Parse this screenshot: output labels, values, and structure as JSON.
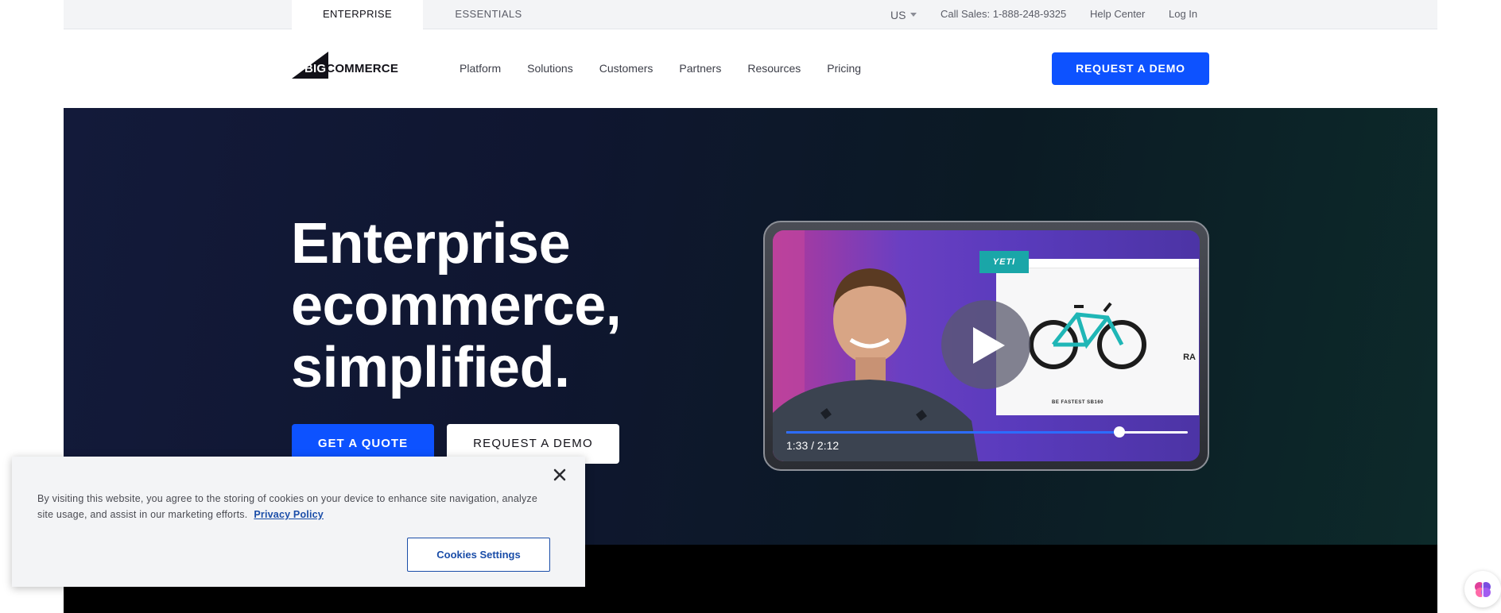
{
  "utility_bar": {
    "tabs": [
      {
        "label": "ENTERPRISE",
        "active": true
      },
      {
        "label": "ESSENTIALS",
        "active": false
      }
    ],
    "region": "US",
    "call_sales": "Call Sales: 1-888-248-9325",
    "help_center": "Help Center",
    "login": "Log In"
  },
  "header": {
    "logo": {
      "part1": "BIG",
      "part2": "COMMERCE"
    },
    "nav": [
      "Platform",
      "Solutions",
      "Customers",
      "Partners",
      "Resources",
      "Pricing"
    ],
    "cta": "REQUEST A DEMO"
  },
  "hero": {
    "title_lines": [
      "Enterprise",
      "ecommerce,",
      "simplified."
    ],
    "primary_cta": "GET A QUOTE",
    "secondary_cta": "REQUEST A DEMO"
  },
  "video": {
    "brand_badge": "YETI",
    "store_caption": "BE FASTEST  SB160",
    "store_side_text": "RA",
    "time": "1:33 / 2:12",
    "progress_fraction": 0.83,
    "icon": "play-icon"
  },
  "cookie_banner": {
    "text": "By visiting this website, you agree to the storing of cookies on your device to enhance site navigation, analyze site usage, and assist in our marketing efforts.",
    "link": "Privacy Policy",
    "settings_button": "Cookies Settings",
    "close_icon": "close-icon"
  },
  "colors": {
    "accent": "#0d52ff",
    "hero_bg": "#0f1630",
    "cookie_link": "#1a4da8"
  }
}
